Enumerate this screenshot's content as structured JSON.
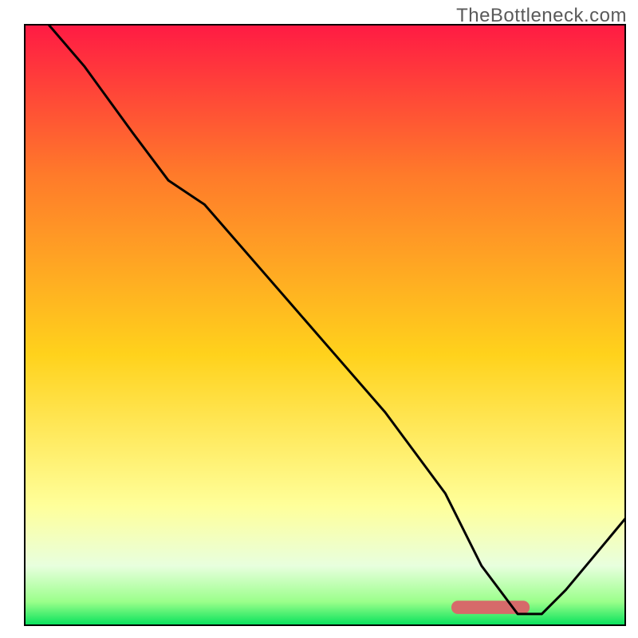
{
  "watermark": "TheBottleneck.com",
  "chart_data": {
    "type": "line",
    "title": "",
    "xlabel": "",
    "ylabel": "",
    "xlim": [
      0,
      100
    ],
    "ylim": [
      0,
      100
    ],
    "series_color": "#000000",
    "background_gradient_top": "#ff1a44",
    "background_gradient_mid_top": "#ff7a2a",
    "background_gradient_mid": "#ffd21c",
    "background_gradient_low": "#ffff9a",
    "background_gradient_lowest_1": "#e8ffde",
    "background_gradient_lowest_2": "#9aff8a",
    "background_gradient_bottom": "#00e05a",
    "highlight_bar_color": "#d66a6a",
    "highlight_bar": {
      "x_start": 71,
      "x_end": 84,
      "y": 2,
      "height": 2.2
    },
    "x": [
      4,
      10,
      18,
      24,
      30,
      40,
      50,
      60,
      70,
      76,
      82,
      86,
      90,
      95,
      100
    ],
    "values": [
      100,
      93,
      82,
      74,
      70,
      58.5,
      47,
      35.5,
      22,
      10,
      2,
      2,
      6,
      12,
      18
    ]
  }
}
